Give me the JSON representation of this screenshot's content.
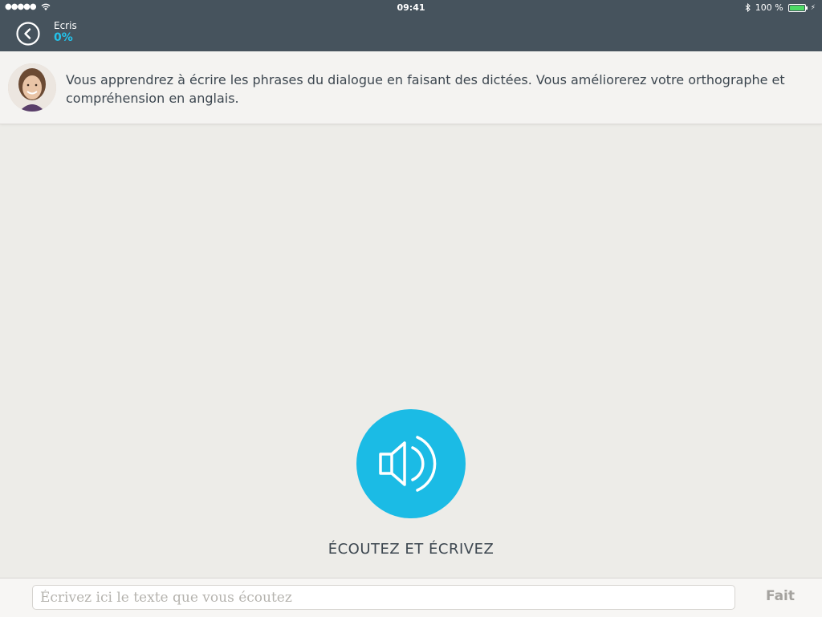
{
  "status_bar": {
    "time": "09:41",
    "battery": "100 %",
    "signal_icon": "signal-dots-icon",
    "wifi_icon": "wifi-icon",
    "bluetooth_icon": "bluetooth-icon"
  },
  "nav": {
    "title": "Ecris",
    "progress": "0%",
    "back_icon": "chevron-left-circle-icon"
  },
  "intro": {
    "avatar_icon": "teacher-avatar",
    "text": "Vous apprendrez à écrire les phrases du dialogue en faisant des dictées.  Vous améliorerez votre orthographe et compréhension en anglais."
  },
  "exercise": {
    "play_icon": "speaker-icon",
    "instruction": "ÉCOUTEZ ET ÉCRIVEZ"
  },
  "answer": {
    "placeholder": "Écrivez ici le texte que vous écoutez",
    "value": "",
    "done_label": "Fait"
  },
  "colors": {
    "nav_bg": "#46535d",
    "accent": "#1bbbe5",
    "progress": "#23c2ea",
    "page_bg": "#edece8"
  }
}
